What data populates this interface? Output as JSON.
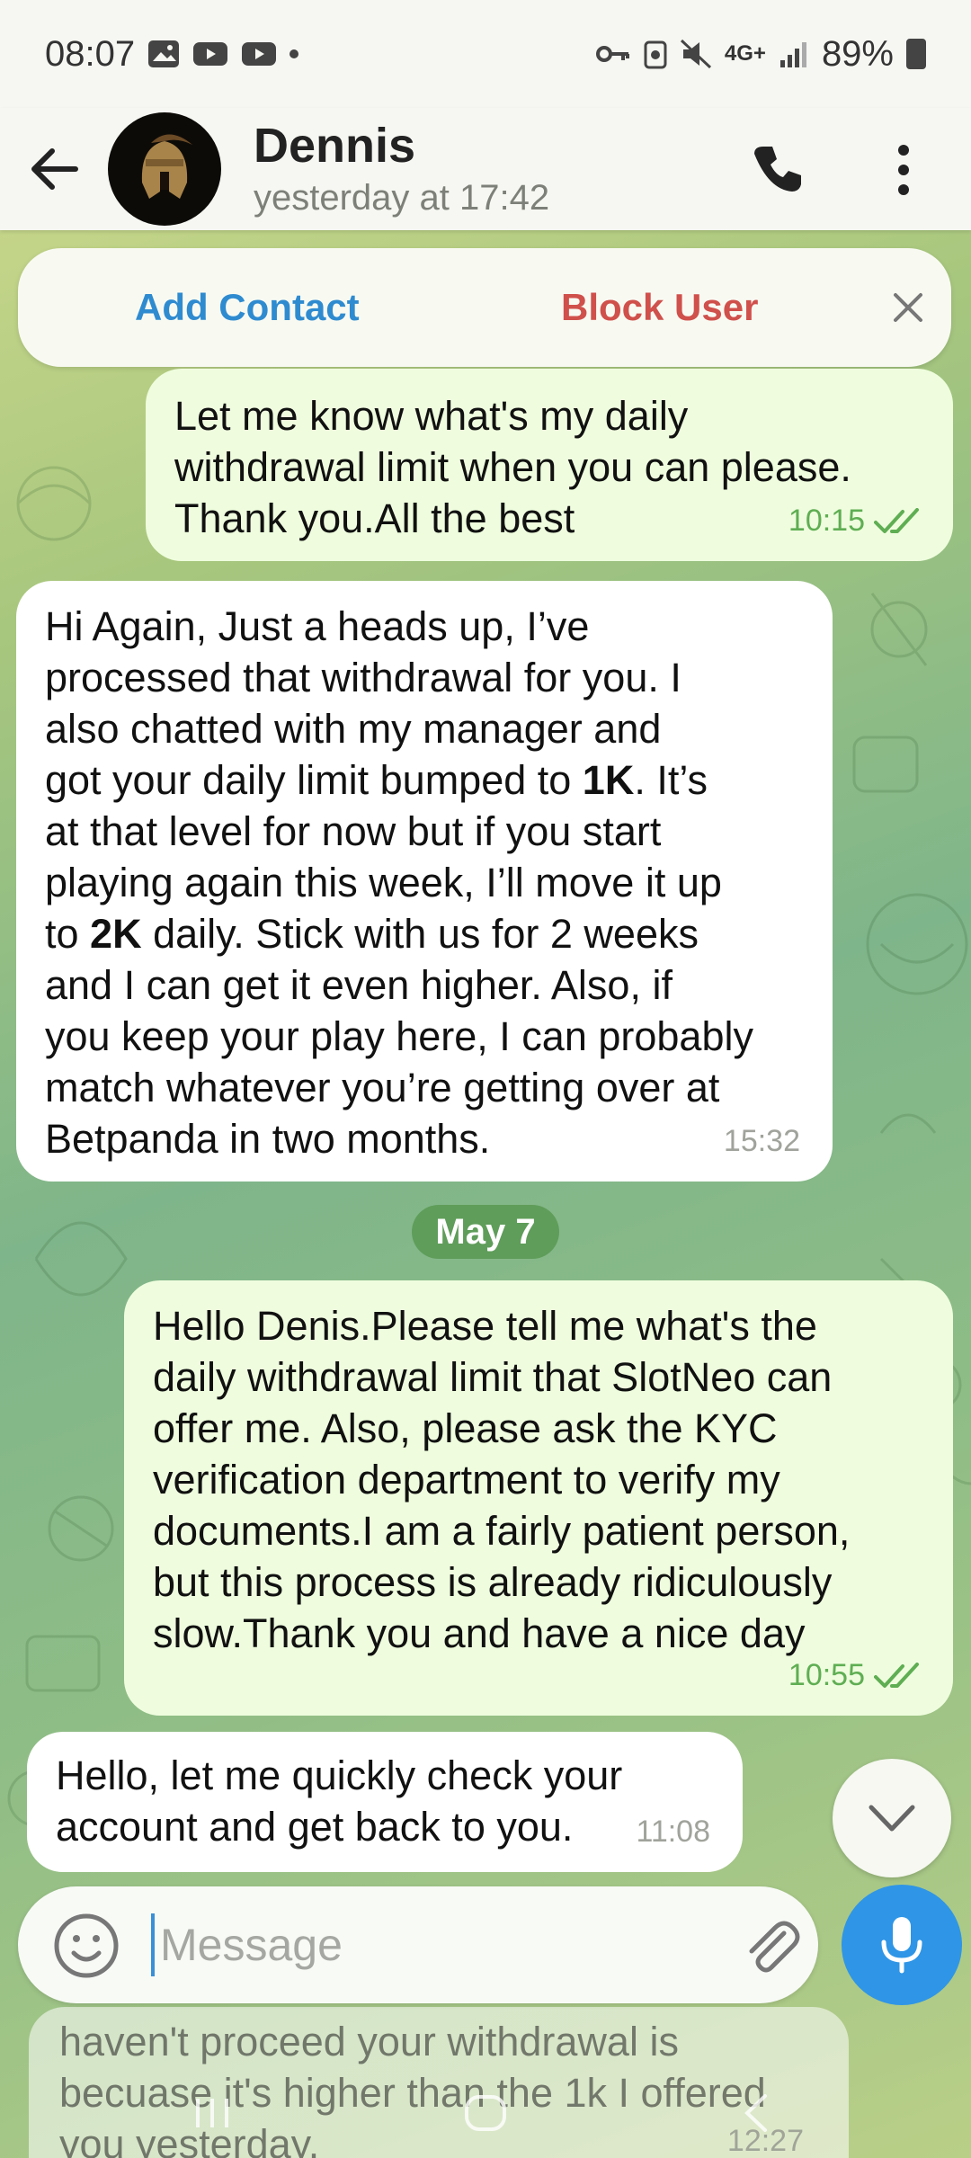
{
  "status_bar": {
    "time": "08:07",
    "network": "4G+",
    "battery": "89%"
  },
  "header": {
    "name": "Dennis",
    "last_seen": "yesterday at 17:42"
  },
  "action_bar": {
    "add_contact": "Add Contact",
    "block_user": "Block User"
  },
  "messages": [
    {
      "direction": "out",
      "text": "Let me know what's my daily\nwithdrawal limit when you can please.\nThank you.All the best",
      "time": "10:15"
    },
    {
      "direction": "in",
      "line1": "Hi Again, Just a heads up, I’ve\nprocessed that withdrawal for you. I\nalso chatted with my manager and\ngot your daily limit bumped to ",
      "bold1": "1K",
      "line2": ". It’s\nat that level for now but if you start\nplaying again this week, I’ll move it up\nto ",
      "bold2": "2K",
      "line3": " daily. Stick with us for 2 weeks\nand I can get it even higher. Also, if\nyou keep your play here, I can probably\nmatch whatever you’re getting over at\nBetpanda in two months.",
      "time": "15:32"
    },
    {
      "direction": "out",
      "text": "Hello Denis.Please tell me what's the\ndaily withdrawal limit that SlotNeo can\noffer me. Also, please ask the KYC\nverification department to verify my\ndocuments.I am a fairly patient person,\nbut this process is already ridiculously\nslow.Thank you and have a nice day",
      "time": "10:55"
    },
    {
      "direction": "in",
      "text": "Hello, let me quickly check your\naccount and get back to you.",
      "time": "11:08"
    }
  ],
  "date_separator": "May 7",
  "input": {
    "placeholder": "Message"
  },
  "preview_message": {
    "text": "haven't proceed your withdrawal is\nbecuase it's higher than the 1k I offered\nyou yesterday.",
    "time": "12:27"
  },
  "colors": {
    "outgoing_bubble": "#effdde",
    "incoming_bubble": "#ffffff",
    "accent_blue": "#2f95e6",
    "block_red": "#d0504c",
    "check_green": "#5fae53"
  }
}
